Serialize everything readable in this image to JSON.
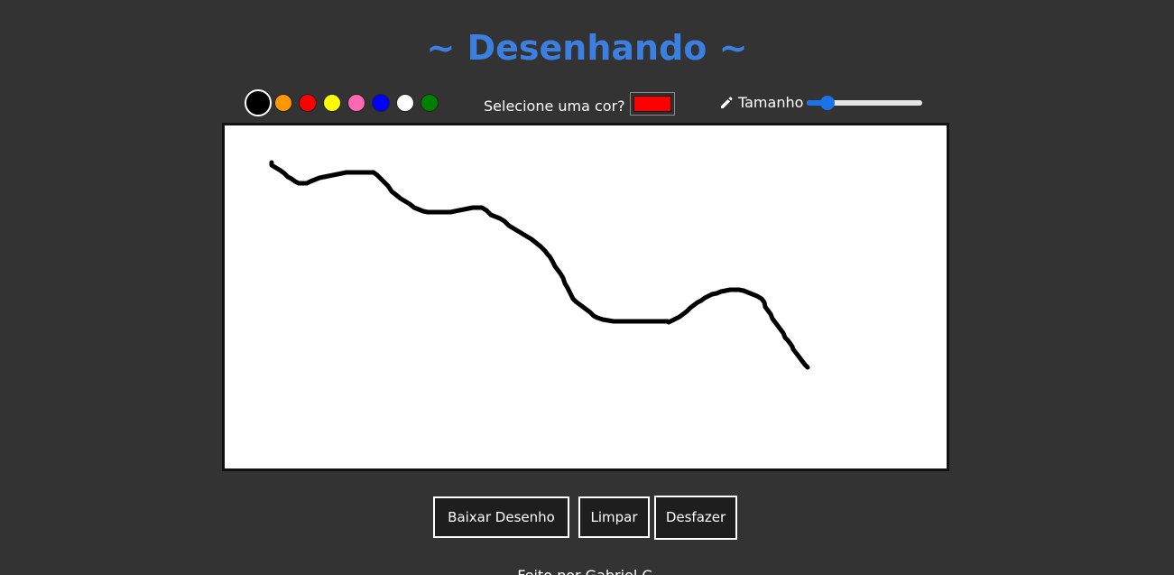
{
  "header": {
    "title": "~ Desenhando ~",
    "title_color": "#3b7fe0"
  },
  "toolbar": {
    "palette": [
      {
        "name": "black",
        "color": "#000000",
        "selected": true
      },
      {
        "name": "orange",
        "color": "#ff9800",
        "selected": false
      },
      {
        "name": "red",
        "color": "#ff0000",
        "selected": false
      },
      {
        "name": "yellow",
        "color": "#ffff00",
        "selected": false
      },
      {
        "name": "pink",
        "color": "#ff69b4",
        "selected": false
      },
      {
        "name": "blue",
        "color": "#0000ff",
        "selected": false
      },
      {
        "name": "white",
        "color": "#ffffff",
        "selected": false
      },
      {
        "name": "green",
        "color": "#008000",
        "selected": false
      }
    ],
    "color_picker_label": "Selecione uma cor?",
    "color_picker_value": "#ff0000",
    "size_icon": "pencil-icon",
    "size_label": "Tamanho",
    "size_slider_value": 0.18
  },
  "canvas": {
    "background": "#ffffff",
    "stroke_color": "#000000"
  },
  "buttons": {
    "download_label": "Baixar Desenho",
    "clear_label": "Limpar",
    "undo_label": "Desfazer"
  },
  "footer": {
    "text": "Feito por Gabriel C."
  }
}
